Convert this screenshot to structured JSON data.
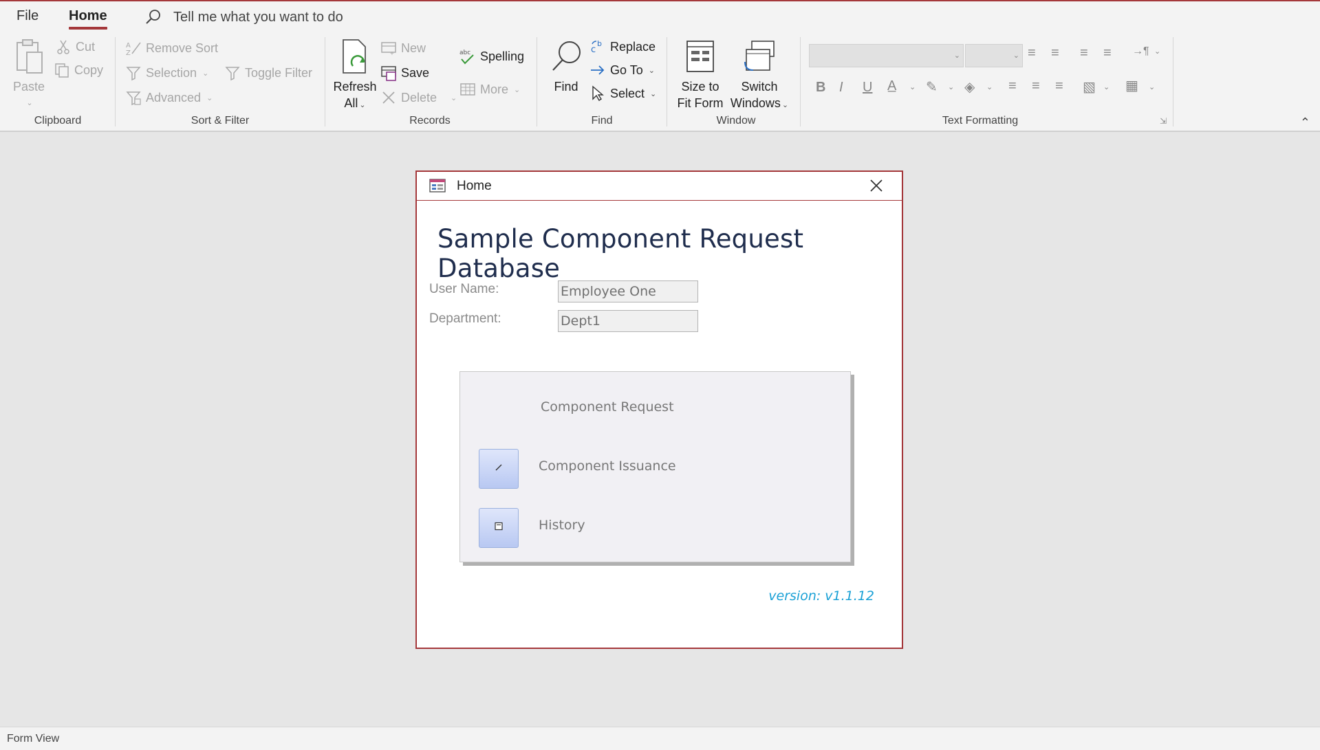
{
  "tabs": {
    "file": "File",
    "home": "Home"
  },
  "tell_me": "Tell me what you want to do",
  "ribbon": {
    "clipboard": {
      "label": "Clipboard",
      "paste": "Paste",
      "cut": "Cut",
      "copy": "Copy"
    },
    "sort_filter": {
      "label": "Sort & Filter",
      "remove_sort": "Remove Sort",
      "selection": "Selection",
      "advanced": "Advanced",
      "toggle_filter": "Toggle Filter"
    },
    "records": {
      "label": "Records",
      "refresh_line1": "Refresh",
      "refresh_line2": "All",
      "new": "New",
      "save": "Save",
      "delete": "Delete",
      "spelling": "Spelling",
      "more": "More"
    },
    "find": {
      "label": "Find",
      "find": "Find",
      "replace": "Replace",
      "goto": "Go To",
      "select": "Select"
    },
    "window": {
      "label": "Window",
      "size_line1": "Size to",
      "size_line2": "Fit Form",
      "switch_line1": "Switch",
      "switch_line2": "Windows"
    },
    "text_formatting": {
      "label": "Text Formatting",
      "bold": "B",
      "italic": "I",
      "underline": "U"
    }
  },
  "form": {
    "window_title": "Home",
    "heading": "Sample Component Request Database",
    "user_name_label": "User Name:",
    "user_name_value": "Employee One",
    "department_label": "Department:",
    "department_value": "Dept1",
    "menu": {
      "component_request": "Component Request",
      "component_issuance": "Component Issuance",
      "history": "History"
    },
    "version": "version: v1.1.12"
  },
  "status_bar": {
    "view": "Form View"
  },
  "colors": {
    "accent": "#a4373a",
    "title": "#1f2d4d",
    "version": "#1ba1d6"
  }
}
